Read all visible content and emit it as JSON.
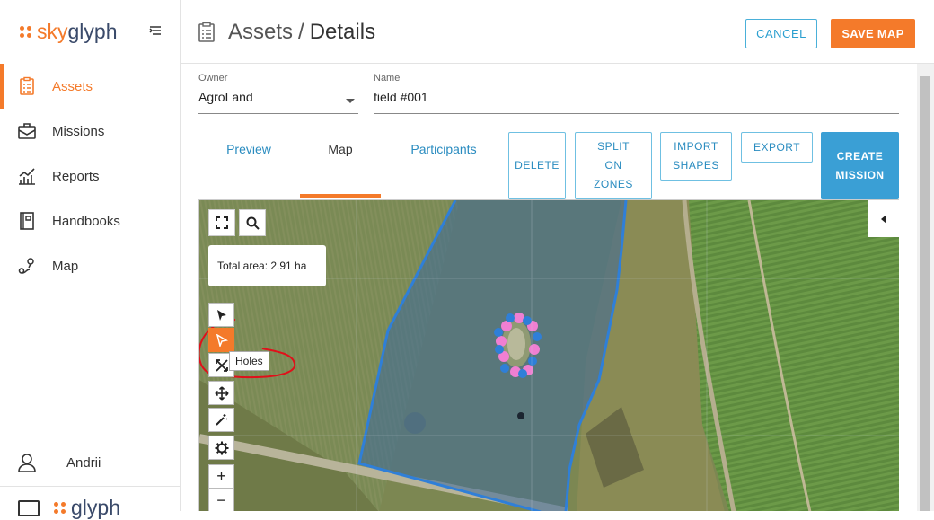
{
  "app": {
    "logo_prefix": "sky",
    "logo_suffix": "glyph",
    "brand_color": "#f47a2a",
    "accent_color": "#3a9fd5"
  },
  "sidebar": {
    "items": [
      {
        "label": "Assets",
        "icon": "clipboard-icon",
        "active": true
      },
      {
        "label": "Missions",
        "icon": "briefcase-icon",
        "active": false
      },
      {
        "label": "Reports",
        "icon": "chart-icon",
        "active": false
      },
      {
        "label": "Handbooks",
        "icon": "book-icon",
        "active": false
      },
      {
        "label": "Map",
        "icon": "map-pin-icon",
        "active": false
      }
    ],
    "user": {
      "name": "Andrii",
      "icon": "user-icon"
    }
  },
  "header": {
    "breadcrumb_parent": "Assets",
    "breadcrumb_separator": "/",
    "breadcrumb_current": "Details",
    "cancel_label": "CANCEL",
    "save_label": "SAVE MAP"
  },
  "form": {
    "owner_label": "Owner",
    "owner_value": "AgroLand",
    "name_label": "Name",
    "name_value": "field #001"
  },
  "tabs": [
    {
      "label": "Preview",
      "active": false
    },
    {
      "label": "Map",
      "active": true
    },
    {
      "label": "Participants",
      "active": false
    }
  ],
  "actions": {
    "delete": "DELETE",
    "split_line1": "SPLIT",
    "split_line2": "ON",
    "split_line3": "ZONES",
    "import_line1": "IMPORT",
    "import_line2": "SHAPES",
    "export": "EXPORT",
    "create_line1": "CREATE",
    "create_line2": "MISSION"
  },
  "map": {
    "total_area": "Total area: 2.91 ha",
    "tooltip": "Holes",
    "zoom_in": "+",
    "zoom_out": "−",
    "tools": [
      "select-arrow-icon",
      "holes-arrow-icon",
      "expand-icon",
      "move-icon",
      "magic-wand-icon",
      "gear-icon"
    ]
  }
}
